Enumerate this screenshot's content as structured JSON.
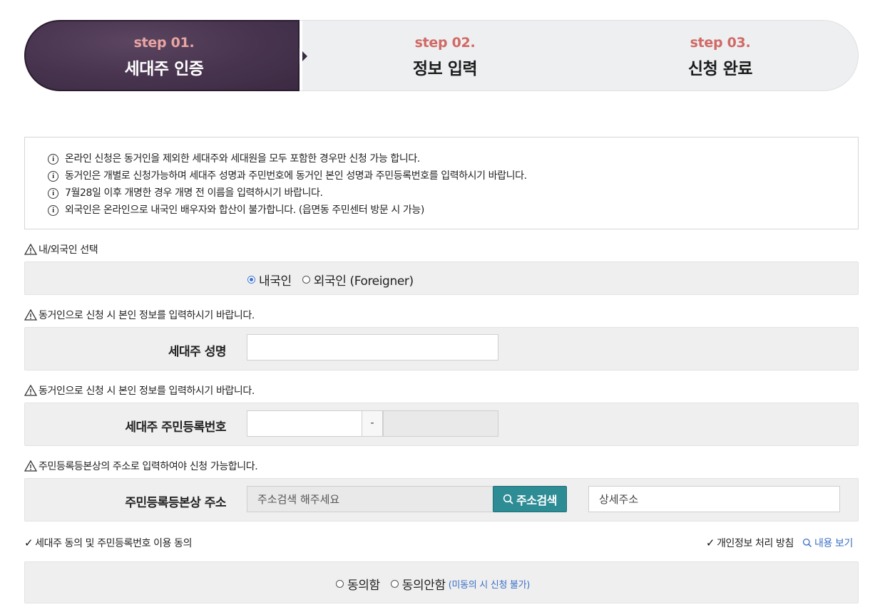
{
  "stepper": {
    "steps": [
      {
        "num": "step 01.",
        "title": "세대주 인증",
        "active": true
      },
      {
        "num": "step 02.",
        "title": "정보 입력",
        "active": false
      },
      {
        "num": "step 03.",
        "title": "신청 완료",
        "active": false
      }
    ]
  },
  "notice": {
    "items": [
      "온라인 신청은 동거인을 제외한 세대주와 세대원을 모두 포함한 경우만 신청 가능 합니다.",
      "동거인은 개별로 신청가능하며 세대주 성명과 주민번호에 동거인 본인 성명과 주민등록번호를 입력하시기 바랍니다.",
      "7월28일 이후 개명한 경우 개명 전 이름을 입력하시기 바랍니다.",
      "외국인은 온라인으로 내국인 배우자와 합산이 불가합니다. (읍면동 주민센터 방문 시 가능)"
    ]
  },
  "nationality": {
    "label": "내/외국인 선택",
    "options": [
      "내국인",
      "외국인 (Foreigner)"
    ],
    "selected": "내국인"
  },
  "name_section": {
    "notice": "동거인으로 신청 시 본인 정보를 입력하시기 바랍니다.",
    "field_label": "세대주 성명",
    "value": ""
  },
  "rrn_section": {
    "notice": "동거인으로 신청 시 본인 정보를 입력하시기 바랍니다.",
    "field_label": "세대주 주민등록번호",
    "dash": "-",
    "first": "",
    "second": ""
  },
  "address_section": {
    "notice": "주민등록등본상의 주소로 입력하여야 신청 가능합니다.",
    "field_label": "주민등록등본상 주소",
    "address_placeholder": "주소검색 해주세요",
    "search_button": "주소검색",
    "detail_placeholder": "상세주소"
  },
  "consent_section": {
    "label": "세대주 동의 및 주민등록번호 이용 동의",
    "privacy_label": "개인정보 처리 방침",
    "view_label": "내용 보기",
    "options": [
      "동의함",
      "동의안함"
    ],
    "note": "(미동의 시 신청 불가)"
  },
  "colors": {
    "active_step": "#47334e",
    "step_num": "#d06a66",
    "search_button": "#2e8c95",
    "link_blue": "#3a6fc5"
  }
}
